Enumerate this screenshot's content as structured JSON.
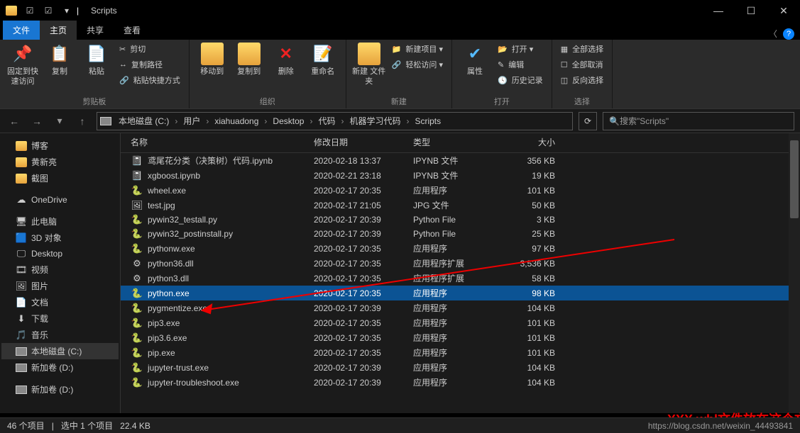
{
  "window_title": "Scripts",
  "ribbon_tabs": {
    "file": "文件",
    "home": "主页",
    "share": "共享",
    "view": "查看"
  },
  "ribbon": {
    "pin": {
      "label": "固定到快\n速访问"
    },
    "copy": {
      "label": "复制"
    },
    "paste": {
      "label": "粘贴"
    },
    "cut": "剪切",
    "copy_path": "复制路径",
    "paste_short": "粘贴快捷方式",
    "clipboard": "剪贴板",
    "moveto": "移动到",
    "copyto": "复制到",
    "delete": "删除",
    "rename": "重命名",
    "organize": "组织",
    "newfolder": "新建\n文件夹",
    "newitem": "新建项目 ▾",
    "easy": "轻松访问 ▾",
    "new": "新建",
    "props": "属性",
    "open": "打开 ▾",
    "edit": "编辑",
    "history": "历史记录",
    "open_group": "打开",
    "selall": "全部选择",
    "selnone": "全部取消",
    "selinv": "反向选择",
    "select": "选择"
  },
  "breadcrumb": [
    "本地磁盘 (C:)",
    "用户",
    "xiahuadong",
    "Desktop",
    "代码",
    "机器学习代码",
    "Scripts"
  ],
  "search_placeholder": "搜索\"Scripts\"",
  "columns": {
    "name": "名称",
    "date": "修改日期",
    "type": "类型",
    "size": "大小"
  },
  "sidebar": [
    {
      "label": "博客",
      "icon": "fld"
    },
    {
      "label": "黄新亮",
      "icon": "fld"
    },
    {
      "label": "截图",
      "icon": "fld"
    },
    {
      "label": "OneDrive",
      "icon": "☁",
      "spacer_before": true
    },
    {
      "label": "此电脑",
      "icon": "🖥",
      "spacer_before": true
    },
    {
      "label": "3D 对象",
      "icon": "🟦"
    },
    {
      "label": "Desktop",
      "icon": "🖵"
    },
    {
      "label": "视频",
      "icon": "🎞"
    },
    {
      "label": "图片",
      "icon": "🖼"
    },
    {
      "label": "文档",
      "icon": "📄"
    },
    {
      "label": "下载",
      "icon": "⬇"
    },
    {
      "label": "音乐",
      "icon": "🎵"
    },
    {
      "label": "本地磁盘 (C:)",
      "icon": "drv",
      "sel": true
    },
    {
      "label": "新加卷 (D:)",
      "icon": "drv"
    },
    {
      "label": "新加卷 (D:)",
      "icon": "drv",
      "spacer_before": true
    }
  ],
  "files": [
    {
      "name": "鸢尾花分类（决策树）代码.ipynb",
      "date": "2020-02-18 13:37",
      "type": "IPYNB 文件",
      "size": "356 KB",
      "ic": "📓"
    },
    {
      "name": "xgboost.ipynb",
      "date": "2020-02-21 23:18",
      "type": "IPYNB 文件",
      "size": "19 KB",
      "ic": "📓"
    },
    {
      "name": "wheel.exe",
      "date": "2020-02-17 20:35",
      "type": "应用程序",
      "size": "101 KB",
      "ic": "🐍"
    },
    {
      "name": "test.jpg",
      "date": "2020-02-17 21:05",
      "type": "JPG 文件",
      "size": "50 KB",
      "ic": "🖼"
    },
    {
      "name": "pywin32_testall.py",
      "date": "2020-02-17 20:39",
      "type": "Python File",
      "size": "3 KB",
      "ic": "🐍"
    },
    {
      "name": "pywin32_postinstall.py",
      "date": "2020-02-17 20:39",
      "type": "Python File",
      "size": "25 KB",
      "ic": "🐍"
    },
    {
      "name": "pythonw.exe",
      "date": "2020-02-17 20:35",
      "type": "应用程序",
      "size": "97 KB",
      "ic": "🐍"
    },
    {
      "name": "python36.dll",
      "date": "2020-02-17 20:35",
      "type": "应用程序扩展",
      "size": "3,536 KB",
      "ic": "⚙"
    },
    {
      "name": "python3.dll",
      "date": "2020-02-17 20:35",
      "type": "应用程序扩展",
      "size": "58 KB",
      "ic": "⚙"
    },
    {
      "name": "python.exe",
      "date": "2020-02-17 20:35",
      "type": "应用程序",
      "size": "98 KB",
      "ic": "🐍",
      "sel": true
    },
    {
      "name": "pygmentize.exe",
      "date": "2020-02-17 20:39",
      "type": "应用程序",
      "size": "104 KB",
      "ic": "🐍"
    },
    {
      "name": "pip3.exe",
      "date": "2020-02-17 20:35",
      "type": "应用程序",
      "size": "101 KB",
      "ic": "🐍"
    },
    {
      "name": "pip3.6.exe",
      "date": "2020-02-17 20:35",
      "type": "应用程序",
      "size": "101 KB",
      "ic": "🐍"
    },
    {
      "name": "pip.exe",
      "date": "2020-02-17 20:35",
      "type": "应用程序",
      "size": "101 KB",
      "ic": "🐍"
    },
    {
      "name": "jupyter-trust.exe",
      "date": "2020-02-17 20:39",
      "type": "应用程序",
      "size": "104 KB",
      "ic": "🐍"
    },
    {
      "name": "jupyter-troubleshoot.exe",
      "date": "2020-02-17 20:39",
      "type": "应用程序",
      "size": "104 KB",
      "ic": "🐍"
    }
  ],
  "annotation": "XXX.whl文件放在这个文件夹中",
  "status": {
    "count": "46 个项目",
    "sel": "选中 1 个项目",
    "size": "22.4 KB"
  },
  "watermark": "https://blog.csdn.net/weixin_44493841"
}
